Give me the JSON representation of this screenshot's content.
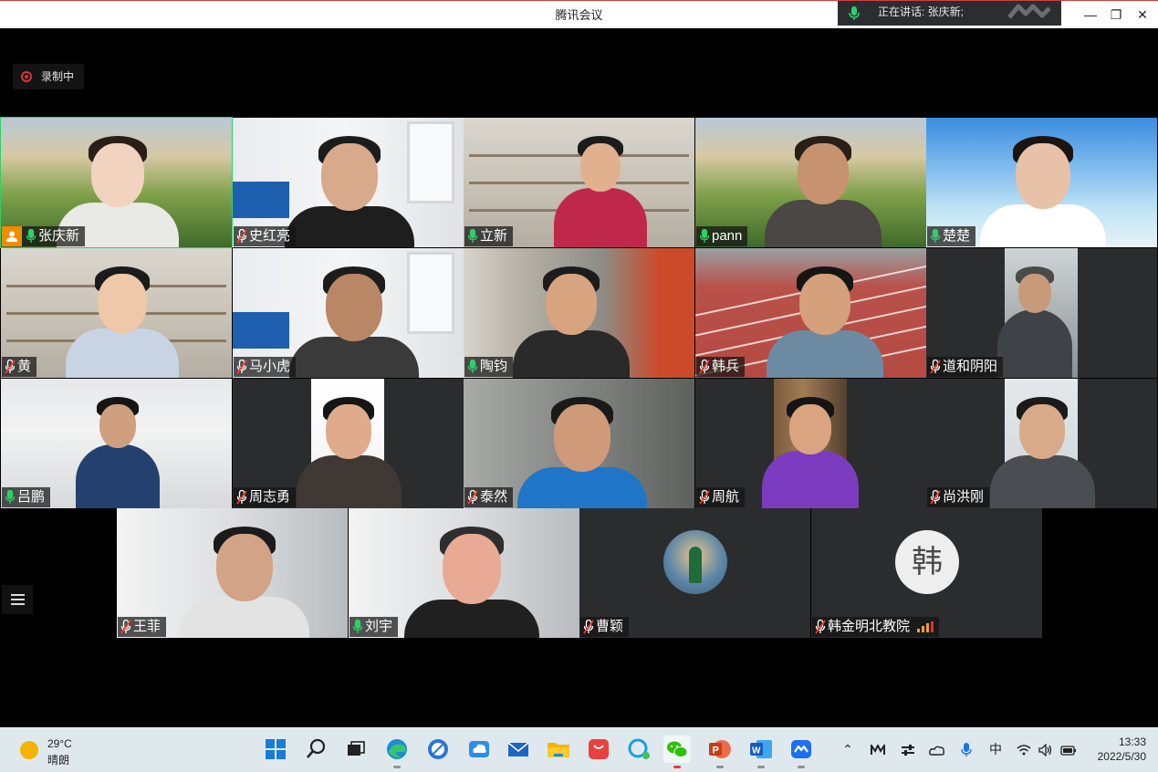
{
  "window": {
    "title": "腾讯会议",
    "speaking": "正在讲话: 张庆新;",
    "controls": {
      "minimize": "—",
      "restore": "❐",
      "close": "✕"
    }
  },
  "recording": {
    "label": "录制中"
  },
  "participants": [
    {
      "name": "张庆新",
      "mic": "on",
      "host": true
    },
    {
      "name": "史红亮",
      "mic": "off"
    },
    {
      "name": "立新",
      "mic": "on"
    },
    {
      "name": "pann",
      "mic": "on"
    },
    {
      "name": "楚楚",
      "mic": "on"
    },
    {
      "name": "黄",
      "mic": "off"
    },
    {
      "name": "马小虎",
      "mic": "off"
    },
    {
      "name": "陶钧",
      "mic": "on"
    },
    {
      "name": "韩兵",
      "mic": "off"
    },
    {
      "name": "道和阴阳",
      "mic": "off"
    },
    {
      "name": "吕鹏",
      "mic": "on"
    },
    {
      "name": "周志勇",
      "mic": "off"
    },
    {
      "name": "泰然",
      "mic": "off"
    },
    {
      "name": "周航",
      "mic": "off"
    },
    {
      "name": "尚洪刚",
      "mic": "off"
    },
    {
      "name": "王菲",
      "mic": "off"
    },
    {
      "name": "刘宇",
      "mic": "on"
    },
    {
      "name": "曹颖",
      "mic": "off",
      "avatar": true
    },
    {
      "name": "韩金明北教院",
      "mic": "off",
      "avatar": true,
      "avatar_char": "韩",
      "signal": true
    }
  ],
  "taskbar": {
    "weather": {
      "temp": "29°C",
      "condition": "晴朗"
    },
    "apps": [
      "start-icon",
      "search-icon",
      "task-view-icon",
      "edge-icon",
      "browser-icon",
      "cloud-icon",
      "mail-icon",
      "file-explorer-icon",
      "huawei-appgallery-icon",
      "qq-icon",
      "wechat-icon",
      "powerpoint-icon",
      "word-icon",
      "tencent-meeting-icon"
    ],
    "tray": {
      "ime": "中"
    },
    "clock": {
      "time": "13:33",
      "date": "2022/5/30"
    }
  }
}
